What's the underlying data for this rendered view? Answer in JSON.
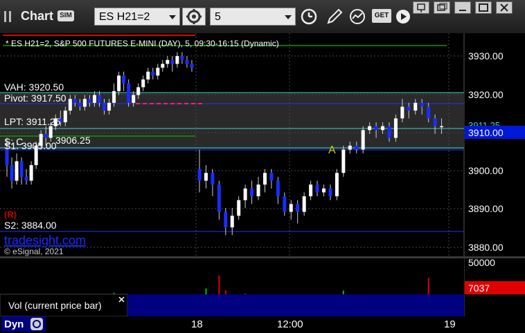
{
  "toolbar": {
    "title": "Chart",
    "sim_badge": "SIM",
    "symbol_value": "ES H21=2",
    "interval_value": "5",
    "get_label": "GET"
  },
  "chart_header": "* ES H21=2, S&P 500 FUTURES E-MINI (DAY), 5, 09:30-16:15 (Dynamic)",
  "copyright": "© eSignal, 2021",
  "watermark": "tradesight.com",
  "r_marker": "(R)",
  "price_axis": {
    "ticks": [
      "3930.00",
      "3920.00",
      "3910.00",
      "3900.00",
      "3890.00",
      "3880.00"
    ],
    "last_price": "3910.00",
    "behind_price": "3911.25"
  },
  "levels": {
    "vah": "VAH: 3920.50",
    "pivot": "Pivot: 3917.50",
    "lpt": "LPT: 3911.25",
    "sc": "S: C",
    "val": "3906.25",
    "s1": "S1: 3905.00",
    "s2": "S2: 3884.00"
  },
  "markers": {
    "a": "A"
  },
  "volume": {
    "label": "Vol (current price bar)",
    "top_tick": "50000",
    "current": "7037"
  },
  "time_axis": [
    "18",
    "12:00",
    "19"
  ],
  "bottom_tab": "Dyn",
  "colors": {
    "up_candle": "#ffffff",
    "down_candle": "#1a2cff",
    "volume_up": "#00c000",
    "volume_down": "#e00000",
    "current_volume": "#e00000",
    "last_price": "#0018d8"
  },
  "chart_data": {
    "type": "candlestick",
    "y_range": [
      3879.0,
      3934.0
    ],
    "volume_range": [
      0,
      50000
    ],
    "candles": [
      [
        3905,
        3901,
        3908,
        3898
      ],
      [
        3901,
        3897,
        3903,
        3895
      ],
      [
        3897,
        3902,
        3904,
        3896
      ],
      [
        3902,
        3898,
        3903,
        3896
      ],
      [
        3898,
        3897,
        3900,
        3896
      ],
      [
        3897,
        3901,
        3902,
        3896
      ],
      [
        3901,
        3906,
        3907,
        3900
      ],
      [
        3906,
        3909,
        3910,
        3905
      ],
      [
        3909,
        3908,
        3911,
        3906
      ],
      [
        3908,
        3911,
        3912,
        3907
      ],
      [
        3911,
        3913,
        3914,
        3910
      ],
      [
        3913,
        3912,
        3915,
        3911
      ],
      [
        3912,
        3915,
        3916,
        3911
      ],
      [
        3915,
        3918,
        3919,
        3914
      ],
      [
        3918,
        3917,
        3919,
        3916
      ],
      [
        3917,
        3916,
        3918,
        3915
      ],
      [
        3916,
        3918,
        3919,
        3915
      ],
      [
        3918,
        3917,
        3919,
        3916
      ],
      [
        3917,
        3919,
        3920,
        3916
      ],
      [
        3919,
        3917,
        3920,
        3916
      ],
      [
        3917,
        3915,
        3918,
        3914
      ],
      [
        3915,
        3917,
        3918,
        3914
      ],
      [
        3917,
        3920,
        3922,
        3916
      ],
      [
        3920,
        3924,
        3925,
        3919
      ],
      [
        3924,
        3922,
        3925,
        3920
      ],
      [
        3922,
        3917,
        3923,
        3916
      ],
      [
        3917,
        3919,
        3920,
        3916
      ],
      [
        3919,
        3921,
        3922,
        3918
      ],
      [
        3921,
        3923,
        3924,
        3920
      ],
      [
        3923,
        3925,
        3926,
        3922
      ],
      [
        3925,
        3924,
        3926,
        3923
      ],
      [
        3924,
        3926,
        3927,
        3923
      ],
      [
        3926,
        3927,
        3928,
        3925
      ],
      [
        3927,
        3928,
        3929,
        3926
      ],
      [
        3928,
        3927,
        3929,
        3925
      ],
      [
        3927,
        3929,
        3930,
        3926
      ],
      [
        3929,
        3928,
        3930,
        3927
      ],
      [
        3928,
        3927,
        3929,
        3926
      ],
      [
        3927,
        3926,
        3928,
        3925
      ],
      [
        3900,
        3897,
        3905,
        3894
      ],
      [
        3897,
        3899,
        3901,
        3895
      ],
      [
        3899,
        3896,
        3900,
        3893
      ],
      [
        3896,
        3889,
        3897,
        3887
      ],
      [
        3889,
        3885,
        3890,
        3883
      ],
      [
        3885,
        3888,
        3890,
        3883
      ],
      [
        3888,
        3892,
        3893,
        3887
      ],
      [
        3892,
        3895,
        3896,
        3890
      ],
      [
        3895,
        3893,
        3897,
        3891
      ],
      [
        3893,
        3896,
        3898,
        3892
      ],
      [
        3896,
        3899,
        3900,
        3894
      ],
      [
        3899,
        3897,
        3900,
        3895
      ],
      [
        3897,
        3893,
        3898,
        3891
      ],
      [
        3893,
        3889,
        3894,
        3888
      ],
      [
        3889,
        3891,
        3892,
        3887
      ],
      [
        3891,
        3889,
        3892,
        3886
      ],
      [
        3889,
        3893,
        3894,
        3888
      ],
      [
        3893,
        3896,
        3897,
        3892
      ],
      [
        3896,
        3894,
        3897,
        3893
      ],
      [
        3894,
        3895,
        3896,
        3893
      ],
      [
        3895,
        3893,
        3896,
        3892
      ],
      [
        3893,
        3899,
        3900,
        3892
      ],
      [
        3899,
        3905,
        3906,
        3898
      ],
      [
        3905,
        3906,
        3907,
        3904
      ],
      [
        3906,
        3905,
        3907,
        3904
      ],
      [
        3905,
        3910,
        3911,
        3904
      ],
      [
        3910,
        3911,
        3912,
        3909
      ],
      [
        3911,
        3910,
        3912,
        3908
      ],
      [
        3910,
        3911,
        3912,
        3909
      ],
      [
        3911,
        3908,
        3912,
        3907
      ],
      [
        3908,
        3913,
        3914,
        3907
      ],
      [
        3913,
        3916,
        3918,
        3912
      ],
      [
        3916,
        3915,
        3917,
        3913
      ],
      [
        3915,
        3917,
        3918,
        3914
      ],
      [
        3917,
        3916,
        3918,
        3914
      ],
      [
        3916,
        3913,
        3917,
        3912
      ],
      [
        3913,
        3911,
        3914,
        3909
      ],
      [
        3911,
        3911,
        3913,
        3909
      ]
    ],
    "volumes": [
      9000,
      14000,
      6000,
      18000,
      8000,
      7000,
      12000,
      9000,
      6000,
      8000,
      11000,
      7000,
      9000,
      13000,
      6000,
      8000,
      7000,
      9000,
      6000,
      8000,
      10000,
      7000,
      22000,
      9000,
      16000,
      8000,
      7000,
      9000,
      6000,
      8000,
      7000,
      6000,
      5000,
      7000,
      6000,
      5000,
      6000,
      7000,
      5000,
      20000,
      26000,
      17000,
      38000,
      24000,
      18000,
      16000,
      21000,
      14000,
      12000,
      17000,
      10000,
      13000,
      15000,
      11000,
      9000,
      12000,
      10000,
      8000,
      9000,
      11000,
      14000,
      24000,
      13000,
      10000,
      11000,
      8000,
      9000,
      7000,
      8000,
      10000,
      18000,
      11000,
      12000,
      9000,
      36000,
      14000,
      7037
    ]
  }
}
